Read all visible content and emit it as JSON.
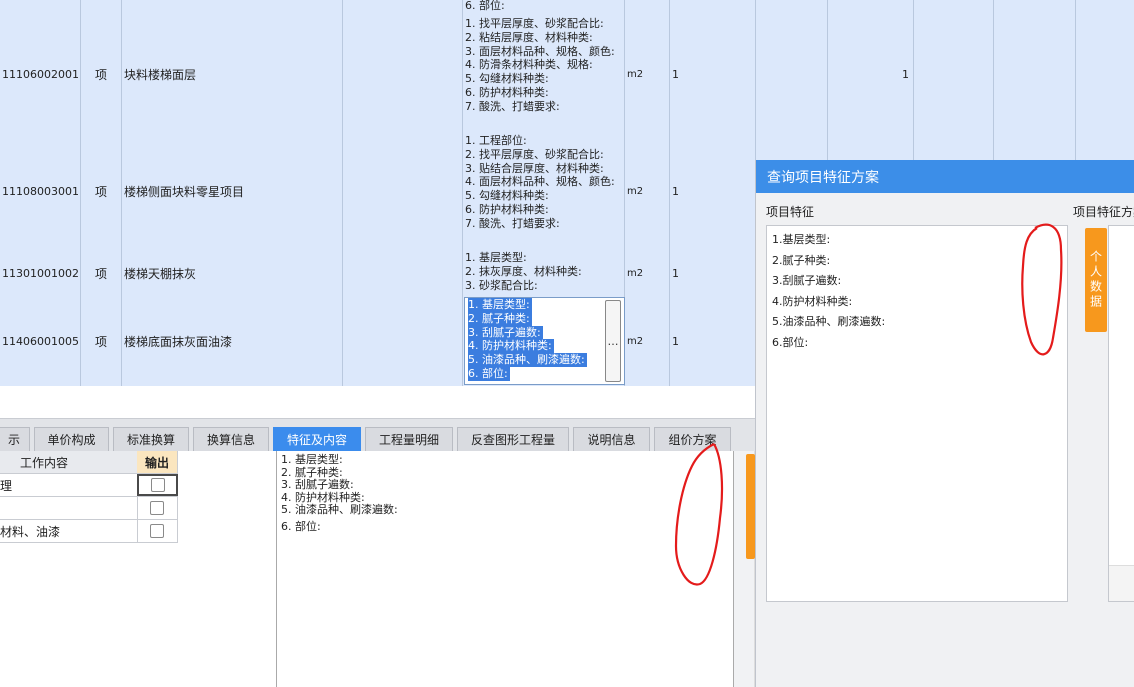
{
  "grid": {
    "top_partial": {
      "feature": "6. 部位:"
    },
    "rows": [
      {
        "code": "11106002001",
        "unit_type": "项",
        "name": "块料楼梯面层",
        "features": [
          "1. 找平层厚度、砂浆配合比:",
          "2. 粘结层厚度、材料种类:",
          "3. 面层材料品种、规格、颜色:",
          "4. 防滑条材料种类、规格:",
          "5. 勾缝材料种类:",
          "6. 防护材料种类:",
          "7. 酸洗、打蜡要求:"
        ],
        "unit": "m2",
        "qty": "1",
        "v2": "1"
      },
      {
        "code": "11108003001",
        "unit_type": "项",
        "name": "楼梯侧面块料零星项目",
        "features": [
          "1. 工程部位:",
          "2. 找平层厚度、砂浆配合比:",
          "3. 贴结合层厚度、材料种类:",
          "4. 面层材料品种、规格、颜色:",
          "5. 勾缝材料种类:",
          "6. 防护材料种类:",
          "7. 酸洗、打蜡要求:"
        ],
        "unit": "m2",
        "qty": "1",
        "v2": ""
      },
      {
        "code": "11301001002",
        "unit_type": "项",
        "name": "楼梯天棚抹灰",
        "features": [
          "1. 基层类型:",
          "2. 抹灰厚度、材料种类:",
          "3. 砂浆配合比:"
        ],
        "unit": "m2",
        "qty": "1",
        "v2": ""
      },
      {
        "code": "11406001005",
        "unit_type": "项",
        "name": "楼梯底面抹灰面油漆",
        "features": [
          "1. 基层类型:",
          "2. 腻子种类:",
          "3. 刮腻子遍数:",
          "4. 防护材料种类:",
          "5. 油漆品种、刷漆遍数:",
          "6. 部位:"
        ],
        "unit": "m2",
        "qty": "1",
        "v2": ""
      }
    ],
    "ellipsis": "…"
  },
  "tabs": [
    {
      "label": "提示",
      "shown": "示"
    },
    {
      "label": "单价构成"
    },
    {
      "label": "标准换算"
    },
    {
      "label": "换算信息"
    },
    {
      "label": "特征及内容"
    },
    {
      "label": "工程量明细"
    },
    {
      "label": "反查图形工程量"
    },
    {
      "label": "说明信息"
    },
    {
      "label": "组价方案"
    }
  ],
  "work_table": {
    "header_content": "工作内容",
    "header_output": "输出",
    "rows": [
      "理",
      "",
      "材料、油漆"
    ]
  },
  "feature_text": [
    "1. 基层类型:",
    "2. 腻子种类:",
    "3. 刮腻子遍数:",
    "4. 防护材料种类:",
    "5. 油漆品种、刷漆遍数:",
    "6. 部位:"
  ],
  "dialog": {
    "title": "查询项目特征方案",
    "left_label": "项目特征",
    "right_label": "项目特征方案",
    "features": [
      "1.基层类型:",
      "2.腻子种类:",
      "3.刮腻子遍数:",
      "4.防护材料种类:",
      "5.油漆品种、刷漆遍数:",
      "6.部位:"
    ],
    "personal_data_button": "个人数据"
  },
  "colors": {
    "accent": "#3c8ee8",
    "orange": "#f7981d",
    "grid_row": "#dce8fb",
    "annotation": "#e41b1b"
  }
}
